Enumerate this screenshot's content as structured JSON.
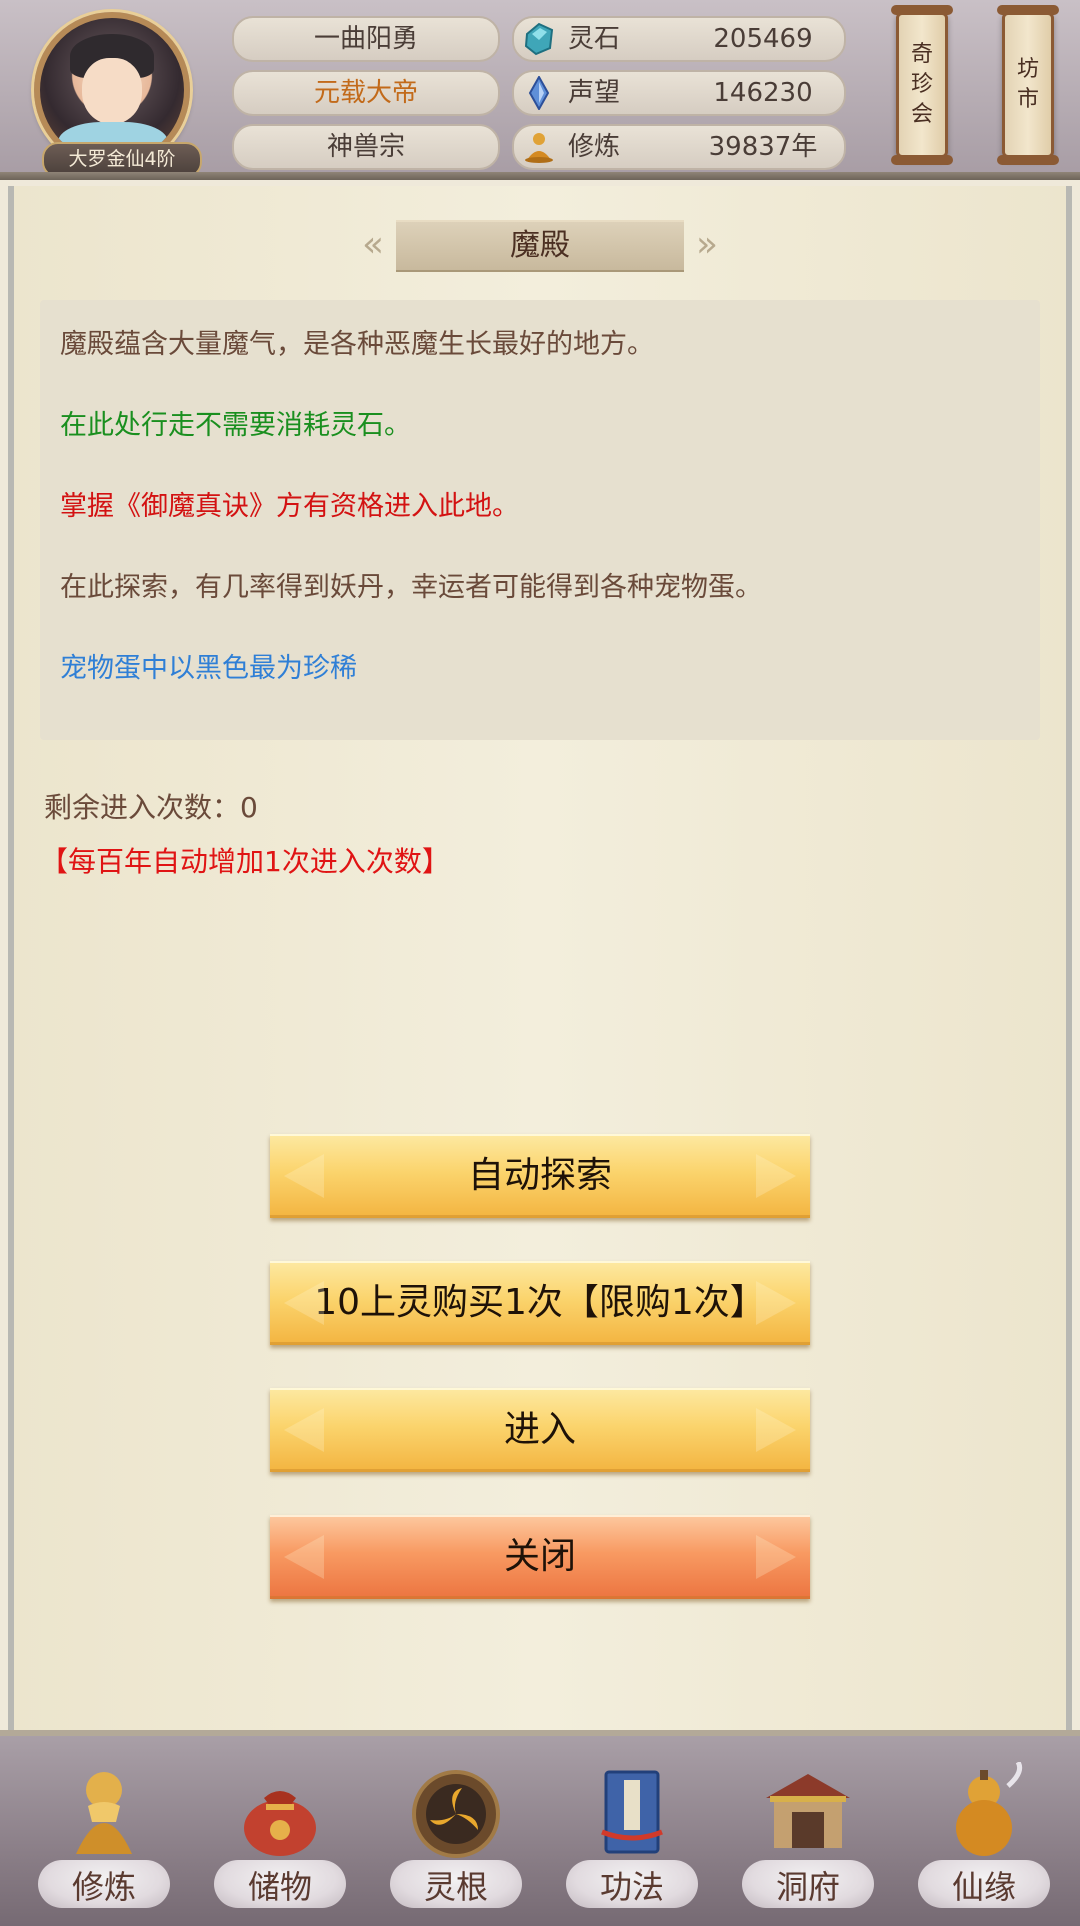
{
  "header": {
    "player_name": "一曲阳勇",
    "title": "元载大帝",
    "sect": "神兽宗",
    "rank": "大罗金仙4阶",
    "resources": [
      {
        "label": "灵石",
        "value": "205469",
        "icon": "spirit-stone-icon"
      },
      {
        "label": "声望",
        "value": "146230",
        "icon": "reputation-crystal-icon"
      },
      {
        "label": "修炼",
        "value": "39837年",
        "icon": "meditation-icon"
      }
    ],
    "scroll_buttons": [
      {
        "label": "奇珍会",
        "chars": [
          "奇",
          "珍",
          "会"
        ]
      },
      {
        "label": "坊市",
        "chars": [
          "坊",
          "市"
        ]
      }
    ]
  },
  "panel": {
    "title": "魔殿",
    "desc_lines": [
      {
        "text": "魔殿蕴含大量魔气，是各种恶魔生长最好的地方。",
        "color": "brown"
      },
      {
        "text": "在此处行走不需要消耗灵石。",
        "color": "green"
      },
      {
        "text": "掌握《御魔真诀》方有资格进入此地。",
        "color": "red"
      },
      {
        "text": "在此探索，有几率得到妖丹，幸运者可能得到各种宠物蛋。",
        "color": "brown"
      },
      {
        "text": "宠物蛋中以黑色最为珍稀",
        "color": "blue"
      }
    ],
    "remaining_label": "剩余进入次数：0",
    "auto_note": "【每百年自动增加1次进入次数】",
    "buttons": {
      "auto_explore": "自动探索",
      "buy_once": "10上灵购买1次【限购1次】",
      "enter": "进入",
      "close": "关闭"
    }
  },
  "nav": {
    "items": [
      {
        "label": "修炼",
        "icon": "meditating-figure-icon"
      },
      {
        "label": "储物",
        "icon": "storage-bag-icon"
      },
      {
        "label": "灵根",
        "icon": "spirit-root-orb-icon"
      },
      {
        "label": "功法",
        "icon": "technique-book-icon"
      },
      {
        "label": "洞府",
        "icon": "cave-mansion-icon"
      },
      {
        "label": "仙缘",
        "icon": "gourd-icon"
      }
    ]
  },
  "colors": {
    "brown_text": "#6a4a3a",
    "green_text": "#1a8f1f",
    "red_text": "#d31212",
    "blue_text": "#2f7fd6",
    "button_gold": "#fbd46d",
    "button_orange": "#f89a62"
  }
}
